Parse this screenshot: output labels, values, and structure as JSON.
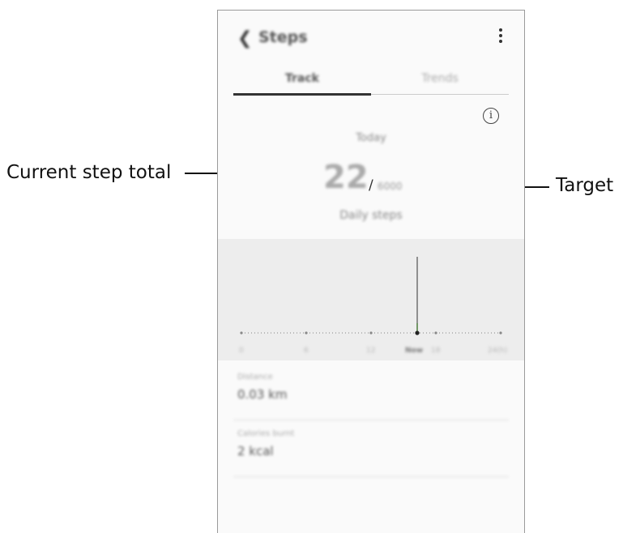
{
  "callouts": {
    "left": "Current step total",
    "right": "Target"
  },
  "app": {
    "back_icon": "chevron-left-icon",
    "title": "Steps",
    "more_icon": "more-vert-icon"
  },
  "tabs": [
    {
      "label": "Track",
      "selected": true
    },
    {
      "label": "Trends",
      "selected": false
    }
  ],
  "summary": {
    "info_icon": "info-icon",
    "day": "Today",
    "steps": "22",
    "separator": "/",
    "target": "6000",
    "caption": "Daily steps"
  },
  "chart": {
    "ticks": [
      "0",
      "6",
      "12",
      "Now",
      "18",
      "24(h)"
    ],
    "now_marker_color": "#333333",
    "bar_color": "#4a7a3a"
  },
  "stats": [
    {
      "label": "Distance",
      "value": "0.03 km"
    },
    {
      "label": "Calories burnt",
      "value": "2 kcal"
    }
  ]
}
